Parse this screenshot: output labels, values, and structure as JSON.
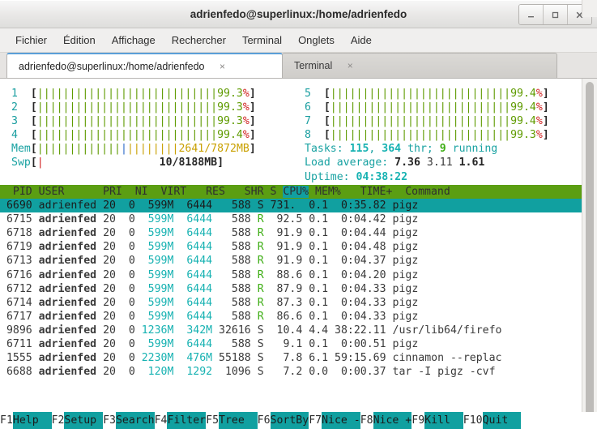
{
  "window": {
    "title": "adrienfedo@superlinux:/home/adrienfedo",
    "buttons": {
      "minimize": "minimize-icon",
      "maximize": "maximize-icon",
      "close": "close-icon"
    }
  },
  "menubar": {
    "items": [
      {
        "label": "Fichier"
      },
      {
        "label": "Édition"
      },
      {
        "label": "Affichage"
      },
      {
        "label": "Rechercher"
      },
      {
        "label": "Terminal"
      },
      {
        "label": "Onglets"
      },
      {
        "label": "Aide"
      }
    ]
  },
  "tabs": [
    {
      "label": "adrienfedo@superlinux:/home/adrienfedo",
      "close": "×",
      "active": true
    },
    {
      "label": "Terminal",
      "close": "×",
      "active": false
    }
  ],
  "htop": {
    "cpus_left": [
      {
        "id": "1",
        "pct": "99.3",
        "bars": 28
      },
      {
        "id": "2",
        "pct": "99.3",
        "bars": 28
      },
      {
        "id": "3",
        "pct": "99.3",
        "bars": 28
      },
      {
        "id": "4",
        "pct": "99.4",
        "bars": 28
      }
    ],
    "cpus_right": [
      {
        "id": "5",
        "pct": "99.4",
        "bars": 28
      },
      {
        "id": "6",
        "pct": "99.4",
        "bars": 28
      },
      {
        "id": "7",
        "pct": "99.4",
        "bars": 28
      },
      {
        "id": "8",
        "pct": "99.3",
        "bars": 28
      }
    ],
    "mem": {
      "label": "Mem",
      "text": "2641/7872MB",
      "green_bars": 13,
      "blue_bars": 1,
      "yellow_bars": 8
    },
    "swp": {
      "label": "Swp",
      "text": "10/8188MB",
      "red_bars": 1
    },
    "tasks": {
      "label": "Tasks: ",
      "total": "115",
      "sep1": ", ",
      "threads": "364",
      "thr_label": " thr; ",
      "running": "9",
      "running_label": " running"
    },
    "load": {
      "label": "Load average: ",
      "v1": "7.36",
      "v2": "3.11",
      "v3": "1.61"
    },
    "uptime": {
      "label": "Uptime: ",
      "value": "04:38:22"
    },
    "columns": [
      "  PID",
      "USER",
      "PRI",
      "NI",
      "VIRT",
      "RES",
      "SHR",
      "S",
      "CPU%",
      "MEM%",
      "TIME+",
      "Command"
    ],
    "header_text": "  PID USER      PRI  NI  VIRT   RES   SHR S ",
    "header_sort": "CPU%",
    "header_rest": " MEM%   TIME+  Command",
    "sort_column": "CPU%",
    "rows": [
      {
        "pid": " 6690",
        "user": "adrienfed",
        "pri": " 20",
        "ni": "  0",
        "virt": " 599M",
        "res": " 6444",
        "shr": "  588",
        "state": "S",
        "cpu": "731. ",
        "mem": " 0.1",
        "time": " 0:35.82",
        "command": "pigz",
        "selected": true
      },
      {
        "pid": " 6715",
        "user": "adrienfed",
        "pri": " 20",
        "ni": "  0",
        "virt": " 599M",
        "res": " 6444",
        "shr": "  588",
        "state": "R",
        "cpu": " 92.5",
        "mem": " 0.1",
        "time": " 0:04.42",
        "command": "pigz",
        "selected": false
      },
      {
        "pid": " 6718",
        "user": "adrienfed",
        "pri": " 20",
        "ni": "  0",
        "virt": " 599M",
        "res": " 6444",
        "shr": "  588",
        "state": "R",
        "cpu": " 91.9",
        "mem": " 0.1",
        "time": " 0:04.44",
        "command": "pigz",
        "selected": false
      },
      {
        "pid": " 6719",
        "user": "adrienfed",
        "pri": " 20",
        "ni": "  0",
        "virt": " 599M",
        "res": " 6444",
        "shr": "  588",
        "state": "R",
        "cpu": " 91.9",
        "mem": " 0.1",
        "time": " 0:04.48",
        "command": "pigz",
        "selected": false
      },
      {
        "pid": " 6713",
        "user": "adrienfed",
        "pri": " 20",
        "ni": "  0",
        "virt": " 599M",
        "res": " 6444",
        "shr": "  588",
        "state": "R",
        "cpu": " 91.9",
        "mem": " 0.1",
        "time": " 0:04.37",
        "command": "pigz",
        "selected": false
      },
      {
        "pid": " 6716",
        "user": "adrienfed",
        "pri": " 20",
        "ni": "  0",
        "virt": " 599M",
        "res": " 6444",
        "shr": "  588",
        "state": "R",
        "cpu": " 88.6",
        "mem": " 0.1",
        "time": " 0:04.20",
        "command": "pigz",
        "selected": false
      },
      {
        "pid": " 6712",
        "user": "adrienfed",
        "pri": " 20",
        "ni": "  0",
        "virt": " 599M",
        "res": " 6444",
        "shr": "  588",
        "state": "R",
        "cpu": " 87.9",
        "mem": " 0.1",
        "time": " 0:04.33",
        "command": "pigz",
        "selected": false
      },
      {
        "pid": " 6714",
        "user": "adrienfed",
        "pri": " 20",
        "ni": "  0",
        "virt": " 599M",
        "res": " 6444",
        "shr": "  588",
        "state": "R",
        "cpu": " 87.3",
        "mem": " 0.1",
        "time": " 0:04.33",
        "command": "pigz",
        "selected": false
      },
      {
        "pid": " 6717",
        "user": "adrienfed",
        "pri": " 20",
        "ni": "  0",
        "virt": " 599M",
        "res": " 6444",
        "shr": "  588",
        "state": "R",
        "cpu": " 86.6",
        "mem": " 0.1",
        "time": " 0:04.33",
        "command": "pigz",
        "selected": false
      },
      {
        "pid": " 9896",
        "user": "adrienfed",
        "pri": " 20",
        "ni": "  0",
        "virt": "1236M",
        "res": " 342M",
        "shr": "32616",
        "state": "S",
        "cpu": " 10.4",
        "mem": " 4.4",
        "time": "38:22.11",
        "command": "/usr/lib64/firefo",
        "selected": false
      },
      {
        "pid": " 6711",
        "user": "adrienfed",
        "pri": " 20",
        "ni": "  0",
        "virt": " 599M",
        "res": " 6444",
        "shr": "  588",
        "state": "S",
        "cpu": "  9.1",
        "mem": " 0.1",
        "time": " 0:00.51",
        "command": "pigz",
        "selected": false
      },
      {
        "pid": " 1555",
        "user": "adrienfed",
        "pri": " 20",
        "ni": "  0",
        "virt": "2230M",
        "res": " 476M",
        "shr": "55188",
        "state": "S",
        "cpu": "  7.8",
        "mem": " 6.1",
        "time": "59:15.69",
        "command": "cinnamon --replac",
        "selected": false
      },
      {
        "pid": " 6688",
        "user": "adrienfed",
        "pri": " 20",
        "ni": "  0",
        "virt": " 120M",
        "res": " 1292",
        "shr": " 1096",
        "state": "S",
        "cpu": "  7.2",
        "mem": " 0.0",
        "time": " 0:00.37",
        "command": "tar -I pigz -cvf",
        "selected": false
      }
    ],
    "fnkeys": [
      {
        "key": "F1",
        "label": "Help  "
      },
      {
        "key": "F2",
        "label": "Setup "
      },
      {
        "key": "F3",
        "label": "Search"
      },
      {
        "key": "F4",
        "label": "Filter"
      },
      {
        "key": "F5",
        "label": "Tree  "
      },
      {
        "key": "F6",
        "label": "SortBy"
      },
      {
        "key": "F7",
        "label": "Nice -"
      },
      {
        "key": "F8",
        "label": "Nice +"
      },
      {
        "key": "F9",
        "label": "Kill  "
      },
      {
        "key": "F10",
        "label": "Quit  "
      }
    ]
  },
  "colors": {
    "accent_green": "#5f9b00",
    "accent_teal": "#11a0a0",
    "accent_yellow": "#c9a000",
    "accent_red": "#d02020",
    "header_green": "#5b9e12",
    "tab_active_border": "#5b9fd8"
  }
}
